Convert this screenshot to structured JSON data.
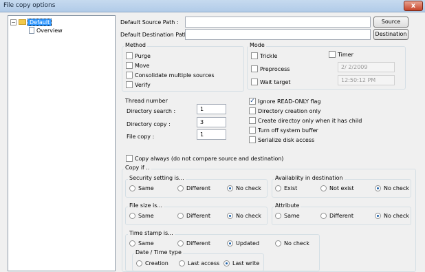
{
  "window": {
    "title": "File copy options",
    "close": "x"
  },
  "tree": {
    "root": "Default",
    "child": "Overview",
    "expander": "−"
  },
  "paths": {
    "source_label": "Default Source Path :",
    "source_value": "",
    "source_button": "Source",
    "dest_label": "Default Destination Path :",
    "dest_value": "",
    "dest_button": "Destination"
  },
  "method": {
    "title": "Method",
    "purge": "Purge",
    "move": "Move",
    "consolidate": "Consolidate multiple sources",
    "verify": "Verify"
  },
  "mode": {
    "title": "Mode",
    "trickle": "Trickle",
    "timer": "Timer",
    "preprocess": "Preprocess",
    "date": "2/ 2/2009",
    "wait_target": "Wait target",
    "time": "12:50:12 PM"
  },
  "thread": {
    "title": "Thread number",
    "dir_search_label": "Directory search :",
    "dir_search": "1",
    "dir_copy_label": "Directory copy :",
    "dir_copy": "3",
    "file_copy_label": "File copy :",
    "file_copy": "1"
  },
  "flags": {
    "ignore_readonly": "Ignore READ-ONLY flag",
    "dir_creation_only": "Directory creation only",
    "create_dir_child": "Create directoy only when it has child",
    "turn_off_buffer": "Turn off system buffer",
    "serialize": "Serialize disk access"
  },
  "copy_always": "Copy always (do not compare source and destination)",
  "copy_if": {
    "title": "Copy if ..",
    "security": {
      "title": "Security setting is...",
      "same": "Same",
      "different": "Different",
      "no_check": "No check"
    },
    "availability": {
      "title": "Availablity in destination",
      "exist": "Exist",
      "not_exist": "Not exist",
      "no_check": "No check"
    },
    "file_size": {
      "title": "File size is...",
      "same": "Same",
      "different": "Different",
      "no_check": "No check"
    },
    "attribute": {
      "title": "Attribute",
      "same": "Same",
      "different": "Different",
      "no_check": "No check"
    },
    "time_stamp": {
      "title": "Time stamp is...",
      "same": "Same",
      "different": "Different",
      "updated": "Updated",
      "no_check": "No check"
    },
    "date_time_type": {
      "title": "Date / Time type",
      "creation": "Creation",
      "last_access": "Last access",
      "last_write": "Last write"
    }
  },
  "checked": {
    "ignore_readonly": "✓"
  }
}
